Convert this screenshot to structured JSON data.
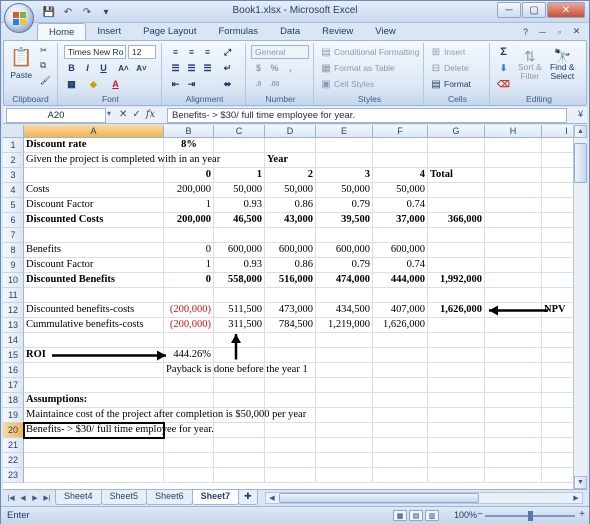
{
  "app": {
    "title": "Book1.xlsx - Microsoft Excel",
    "qat_icons": [
      "save-icon",
      "undo-icon",
      "redo-icon",
      "customize-icon"
    ],
    "window_controls": [
      "minimize",
      "maximize",
      "close"
    ]
  },
  "ribbon": {
    "tabs": [
      "Home",
      "Insert",
      "Page Layout",
      "Formulas",
      "Data",
      "Review",
      "View"
    ],
    "active_tab": "Home",
    "clipboard": {
      "label": "Clipboard",
      "paste": "Paste"
    },
    "font": {
      "label": "Font",
      "name": "Times New Ro",
      "size": "12"
    },
    "alignment": {
      "label": "Alignment"
    },
    "number": {
      "label": "Number",
      "format": "General"
    },
    "styles": {
      "label": "Styles",
      "conditional": "Conditional Formatting",
      "table": "Format as Table",
      "cell": "Cell Styles"
    },
    "cells": {
      "label": "Cells",
      "insert": "Insert",
      "delete": "Delete",
      "format": "Format"
    },
    "editing": {
      "label": "Editing",
      "sort": "Sort &",
      "filter": "Filter",
      "find": "Find &",
      "select": "Select"
    }
  },
  "formula_bar": {
    "name_box": "A20",
    "fx": "fx",
    "content": "Benefits- > $30/ full time employee for year."
  },
  "grid": {
    "columns": [
      "A",
      "B",
      "C",
      "D",
      "E",
      "F",
      "G",
      "H",
      "I"
    ],
    "rows": [
      "1",
      "2",
      "3",
      "4",
      "5",
      "6",
      "7",
      "8",
      "9",
      "10",
      "11",
      "12",
      "13",
      "14",
      "15",
      "16",
      "17",
      "18",
      "19",
      "20",
      "21",
      "22",
      "23"
    ],
    "selected_cell": "A20",
    "cells": {
      "A1": "Discount rate",
      "B1": "8%",
      "A2": "Given the project is completed with in an year",
      "D2": "Year",
      "B3": "0",
      "C3": "1",
      "D3": "2",
      "E3": "3",
      "F3": "4",
      "G3": "Total",
      "A4": "Costs",
      "B4": "200,000",
      "C4": "50,000",
      "D4": "50,000",
      "E4": "50,000",
      "F4": "50,000",
      "A5": "Discount Factor",
      "B5": "1",
      "C5": "0.93",
      "D5": "0.86",
      "E5": "0.79",
      "F5": "0.74",
      "A6": "Discounted Costs",
      "B6": "200,000",
      "C6": "46,500",
      "D6": "43,000",
      "E6": "39,500",
      "F6": "37,000",
      "G6": "366,000",
      "A8": "Benefits",
      "B8": "0",
      "C8": "600,000",
      "D8": "600,000",
      "E8": "600,000",
      "F8": "600,000",
      "A9": "Discount Factor",
      "B9": "1",
      "C9": "0.93",
      "D9": "0.86",
      "E9": "0.79",
      "F9": "0.74",
      "A10": "Discounted Benefits",
      "B10": "0",
      "C10": "558,000",
      "D10": "516,000",
      "E10": "474,000",
      "F10": "444,000",
      "G10": "1,992,000",
      "A12": "Discounted benefits-costs",
      "B12": "(200,000)",
      "C12": "511,500",
      "D12": "473,000",
      "E12": "434,500",
      "F12": "407,000",
      "G12": "1,626,000",
      "I12": "NPV",
      "A13": "Cummulative benefits-costs",
      "B13": "(200,000)",
      "C13": "311,500",
      "D13": "784,500",
      "E13": "1,219,000",
      "F13": "1,626,000",
      "A15": "ROI",
      "B15": "444.26%",
      "B16": "Payback is done before the year 1",
      "A18": "Assumptions:",
      "A19": "Maintaince cost of the project after completion is $50,000 per year",
      "A20": "Benefits- > $30/ full time employee for year."
    }
  },
  "sheets": {
    "tabs": [
      "Sheet4",
      "Sheet5",
      "Sheet6",
      "Sheet7"
    ],
    "active": "Sheet7"
  },
  "status": {
    "mode": "Enter",
    "zoom": "100%",
    "zoom_level_percent": 100
  }
}
